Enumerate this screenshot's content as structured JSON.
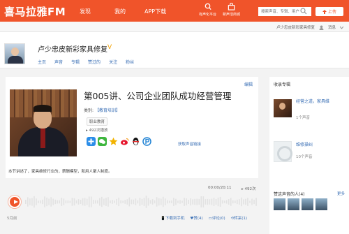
{
  "brand": {
    "logo": "喜马拉雅FM",
    "accent": "#f0542a",
    "link_color": "#3a6fb5"
  },
  "nav": {
    "items": [
      "发现",
      "我的",
      "APP下载"
    ]
  },
  "top_actions": {
    "partner_label": "有声化平台",
    "store_label": "新声活商城",
    "search_placeholder": "搜索声音、专辑、用户",
    "upload_label": "上传"
  },
  "subbar": {
    "username": "卢少忠皮新彩家具修复",
    "messages": "消息"
  },
  "profile": {
    "name": "卢少忠皮新彩家具修复",
    "tabs": [
      "主页",
      "声音",
      "专辑",
      "赞过的",
      "关注",
      "粉丝"
    ]
  },
  "track": {
    "edit_label": "编辑",
    "title": "第005讲、公司企业团队成功经营管理",
    "category_label": "类别:",
    "category": "【教育培训】",
    "tag": "职业教育",
    "plays": "492次播放",
    "share_link": "获取声音链接",
    "intro": "本节讲述了，家具维修行业的，薪酬模型，和用人聚人制度。"
  },
  "player": {
    "time": "00:00/20:11",
    "play_count": "492次",
    "date": "5月前",
    "actions": {
      "download": "下载到手机",
      "like": "赞(4)",
      "comment": "评论(0)",
      "forward": "转采(1)"
    }
  },
  "sidebar": {
    "album_header": "收录专辑",
    "albums": [
      {
        "title": "经营之道，家具维",
        "count": "1个声音"
      },
      {
        "title": "维修操纠",
        "count": "10个声音"
      }
    ],
    "listeners_header": "赞这声音的人(4)",
    "more": "更多"
  }
}
